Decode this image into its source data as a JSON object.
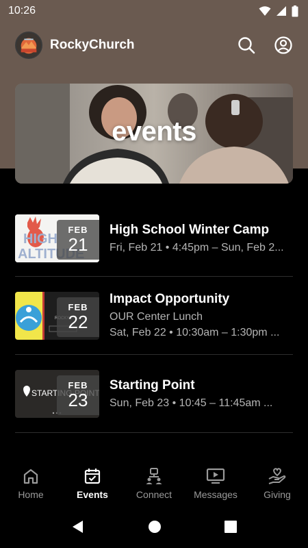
{
  "status": {
    "time": "10:26"
  },
  "app": {
    "title": "RockyChurch"
  },
  "hero": {
    "title": "events"
  },
  "events": [
    {
      "month": "FEB",
      "day": "21",
      "title": "High School Winter Camp",
      "lines": [
        "Fri, Feb 21 • 4:45pm – Sun, Feb 2..."
      ],
      "thumb_text": "HIGH ALTITUDE"
    },
    {
      "month": "FEB",
      "day": "22",
      "title": "Impact Opportunity",
      "lines": [
        "OUR Center Lunch",
        "Sat, Feb 22 • 10:30am – 1:30pm ..."
      ],
      "thumb_text": "ROCKY"
    },
    {
      "month": "FEB",
      "day": "23",
      "title": "Starting Point",
      "lines": [
        "Sun, Feb 23 • 10:45 – 11:45am ..."
      ],
      "thumb_text": "STARTING POINT"
    }
  ],
  "nav": {
    "items": [
      {
        "label": "Home",
        "icon": "home-icon",
        "active": false
      },
      {
        "label": "Events",
        "icon": "calendar-check-icon",
        "active": true
      },
      {
        "label": "Connect",
        "icon": "connect-icon",
        "active": false
      },
      {
        "label": "Messages",
        "icon": "play-screen-icon",
        "active": false
      },
      {
        "label": "Giving",
        "icon": "heart-hand-icon",
        "active": false
      }
    ]
  },
  "colors": {
    "header_bg": "#6a5a50",
    "background": "#000000",
    "muted_text": "#b5b5b5",
    "nav_inactive": "#9a9a9a"
  }
}
